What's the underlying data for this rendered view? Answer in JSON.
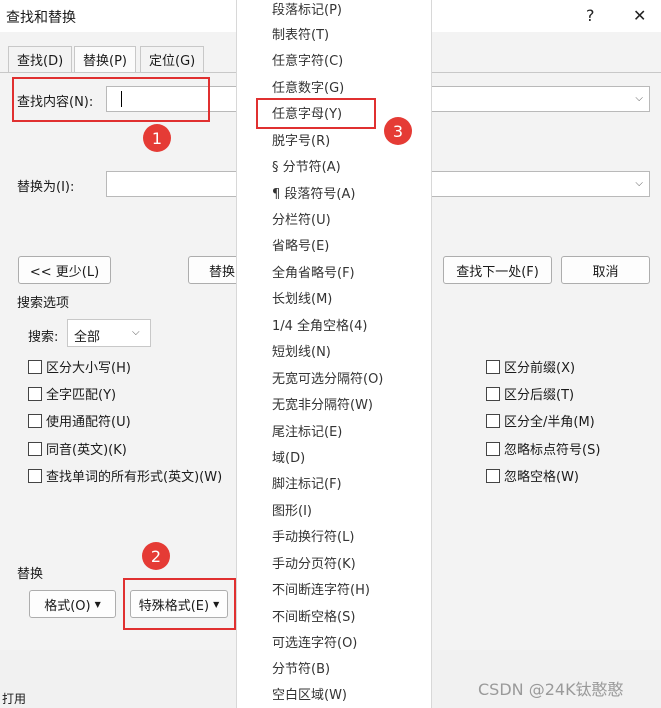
{
  "dialog": {
    "title": "查找和替换",
    "help": "?",
    "close": "✕"
  },
  "tabs": [
    "查找(D)",
    "替换(P)",
    "定位(G)"
  ],
  "find": {
    "label": "查找内容(N):",
    "value": ""
  },
  "replace": {
    "label": "替换为(I):",
    "value": ""
  },
  "buttons": {
    "less": "<< 更少(L)",
    "replace_partial": "替换",
    "find_next": "查找下一处(F)",
    "cancel": "取消",
    "format": "格式(O)",
    "special": "特殊格式(E)"
  },
  "search_options": {
    "heading": "搜索选项",
    "search_label": "搜索:",
    "search_value": "全部",
    "left_options": [
      "区分大小写(H)",
      "全字匹配(Y)",
      "使用通配符(U)",
      "同音(英文)(K)",
      "查找单词的所有形式(英文)(W)"
    ],
    "right_options": [
      "区分前缀(X)",
      "区分后缀(T)",
      "区分全/半角(M)",
      "忽略标点符号(S)",
      "忽略空格(W)"
    ]
  },
  "replace_section": {
    "heading": "替换"
  },
  "special_menu": {
    "items": [
      "段落标记(P)",
      "制表符(T)",
      "任意字符(C)",
      "任意数字(G)",
      "任意字母(Y)",
      "脱字号(R)",
      "§ 分节符(A)",
      "¶ 段落符号(A)",
      "分栏符(U)",
      "省略号(E)",
      "全角省略号(F)",
      "长划线(M)",
      "1/4 全角空格(4)",
      "短划线(N)",
      "无宽可选分隔符(O)",
      "无宽非分隔符(W)",
      "尾注标记(E)",
      "域(D)",
      "脚注标记(F)",
      "图形(I)",
      "手动换行符(L)",
      "手动分页符(K)",
      "不间断连字符(H)",
      "不间断空格(S)",
      "可选连字符(O)",
      "分节符(B)",
      "空白区域(W)"
    ]
  },
  "annotations": {
    "badge1": "1",
    "badge2": "2",
    "badge3": "3"
  },
  "status": {
    "left_text": "打用"
  },
  "watermark": "CSDN @24K钛憨憨",
  "colors": {
    "annotation_red": "#e03030",
    "dialog_bg": "#f3f3f3"
  }
}
